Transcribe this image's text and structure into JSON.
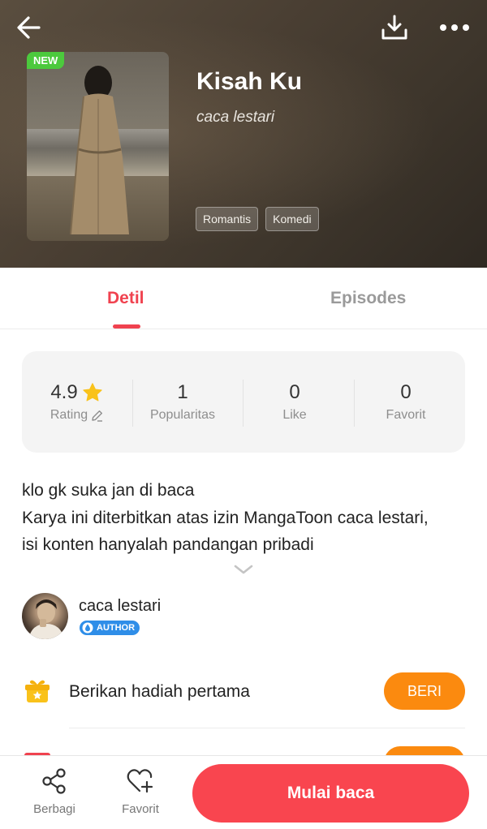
{
  "header": {
    "title": "Kisah Ku",
    "author": "caca lestari",
    "new_badge": "NEW",
    "tags": [
      "Romantis",
      "Komedi"
    ]
  },
  "tabs": {
    "detail": "Detil",
    "episodes": "Episodes"
  },
  "stats": [
    {
      "value": "4.9",
      "label": "Rating"
    },
    {
      "value": "1",
      "label": "Popularitas"
    },
    {
      "value": "0",
      "label": "Like"
    },
    {
      "value": "0",
      "label": "Favorit"
    }
  ],
  "description": {
    "line1": "klo gk suka jan di baca",
    "line2": "Karya ini diterbitkan atas izin MangaToon caca lestari, isi konten hanyalah pandangan pribadi"
  },
  "author_row": {
    "name": "caca lestari",
    "badge": "AUTHOR"
  },
  "gift": {
    "text": "Berikan hadiah pertama",
    "button": "BERI"
  },
  "bottom_bar": {
    "share": "Berbagi",
    "favorite": "Favorit",
    "start_reading": "Mulai baca"
  },
  "colors": {
    "accent": "#f0424f",
    "primary_button": "#f9454f",
    "gift_button": "#fb8a0f",
    "new_badge": "#4cc93d",
    "author_badge": "#2f8ee8",
    "star": "#f9c21b"
  }
}
